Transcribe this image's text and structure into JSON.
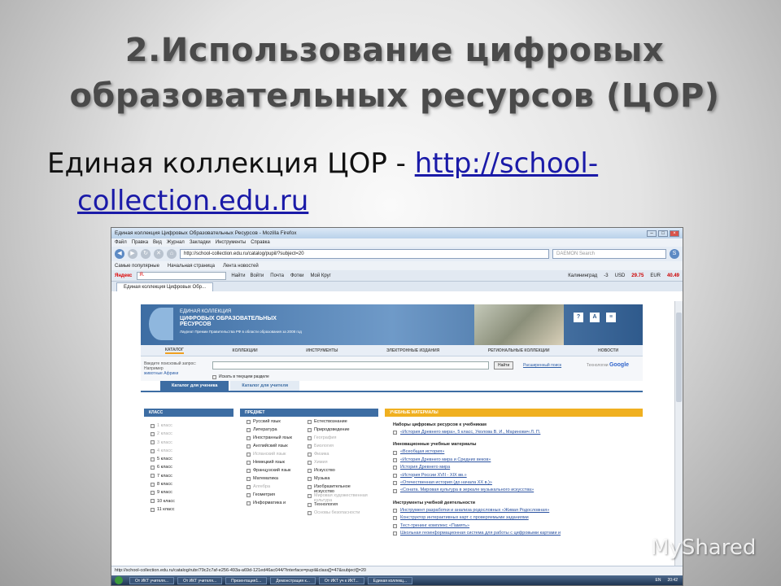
{
  "slide": {
    "title_line1": "2.Использование цифровых",
    "title_line2": "образовательных ресурсов (ЦОР)",
    "subtitle_prefix": "Единая коллекция ЦОР - ",
    "subtitle_link_part1": "http://school-",
    "subtitle_link_part2": "collection.edu.ru",
    "watermark": "MyShared"
  },
  "browser": {
    "window_title": "Единая коллекция Цифровых Образовательных Ресурсов - Mozilla Firefox",
    "menu": [
      "Файл",
      "Правка",
      "Вид",
      "Журнал",
      "Закладки",
      "Инструменты",
      "Справка"
    ],
    "url": "http://school-collection.edu.ru/catalog/pupil/?subject=20",
    "search_placeholder": "DAEMON Search",
    "bookmarks": [
      "Самые популярные",
      "Начальная страница",
      "Лента новостей"
    ],
    "yandex": {
      "logo": "Яндекс",
      "search_field": "Я.",
      "find": "Найти",
      "items": [
        "Войти",
        "Почта",
        "Фотки",
        "Мой Круг"
      ],
      "city": "Калининград",
      "weather": "-3",
      "usd_label": "USD",
      "usd": "29.75",
      "eur_label": "EUR",
      "eur": "40.49"
    },
    "tab": "Единая коллекция Цифровых Обр...",
    "status_url": "http://school-collection.edu.ru/catalog/rubr/79c2c7af-e256-493a-a69d-121ed46ac044/?interface=pupil&class[]=47&subject[]=20"
  },
  "site": {
    "header_line1": "ЕДИНАЯ КОЛЛЕКЦИЯ",
    "header_line2": "ЦИФРОВЫХ ОБРАЗОВАТЕЛЬНЫХ РЕСУРСОВ",
    "header_line3": "Лауреат Премии Правительства РФ в области образования за 2008 год",
    "header_icons": [
      "?",
      "A",
      "≡"
    ],
    "nav": [
      "КАТАЛОГ",
      "КОЛЛЕКЦИИ",
      "ИНСТРУМЕНТЫ",
      "ЭЛЕКТРОННЫЕ ИЗДАНИЯ",
      "РЕГИОНАЛЬНЫЕ КОЛЛЕКЦИИ",
      "НОВОСТИ"
    ],
    "search_label": "Введите поисковый запрос:",
    "search_example_label": "Например",
    "search_example": "животные Африки",
    "search_button": "Найти",
    "advanced_search": "Расширенный поиск",
    "google_prefix": "Технологии",
    "google": "Google",
    "search_in_section": "Искать в текущем разделе",
    "catalog_tabs": [
      "Каталог для ученика",
      "Каталог для учителя"
    ],
    "class_head": "КЛАСС",
    "classes": [
      {
        "label": "1 класс",
        "active": false
      },
      {
        "label": "2 класс",
        "active": false
      },
      {
        "label": "3 класс",
        "active": false
      },
      {
        "label": "4 класс",
        "active": false
      },
      {
        "label": "5 класс",
        "active": true
      },
      {
        "label": "6 класс",
        "active": true
      },
      {
        "label": "7 класс",
        "active": true
      },
      {
        "label": "8 класс",
        "active": true
      },
      {
        "label": "9 класс",
        "active": true
      },
      {
        "label": "10 класс",
        "active": true
      },
      {
        "label": "11 класс",
        "active": true
      }
    ],
    "subject_head": "ПРЕДМЕТ",
    "subjects_col1": [
      {
        "label": "Русский язык",
        "active": true
      },
      {
        "label": "Литература",
        "active": true
      },
      {
        "label": "Иностранный язык",
        "active": true
      },
      {
        "label": "Английский язык",
        "active": true
      },
      {
        "label": "Испанский язык",
        "active": false
      },
      {
        "label": "Немецкий язык",
        "active": true
      },
      {
        "label": "Французский язык",
        "active": true
      },
      {
        "label": "Математика",
        "active": true
      },
      {
        "label": "Алгебра",
        "active": false
      },
      {
        "label": "Геометрия",
        "active": true
      },
      {
        "label": "Информатика и",
        "active": true
      }
    ],
    "subjects_col2": [
      {
        "label": "Естествознание",
        "active": true
      },
      {
        "label": "Природоведение",
        "active": true
      },
      {
        "label": "География",
        "active": false
      },
      {
        "label": "Биология",
        "active": false
      },
      {
        "label": "Физика",
        "active": false
      },
      {
        "label": "Химия",
        "active": false
      },
      {
        "label": "Искусство",
        "active": true
      },
      {
        "label": "Музыка",
        "active": true
      },
      {
        "label": "Изобразительное искусство",
        "active": true
      },
      {
        "label": "Мировая художественная культура",
        "active": false
      },
      {
        "label": "Технология",
        "active": true
      },
      {
        "label": "Основы безопасности",
        "active": false
      }
    ],
    "materials_head": "УЧЕБНЫЕ МАТЕРИАЛЫ",
    "materials_sections": [
      {
        "title": "Наборы цифровых ресурсов к учебникам",
        "items": [
          "«История Древнего мира», 5 класс, Уколова В. И., Маринович Л. П."
        ]
      },
      {
        "title": "Инновационные учебные материалы",
        "items": [
          "«Всеобщая история»",
          "«История Древнего мира и Средних веков»",
          "История Древнего мира",
          "«История России XVII - XIX вв.»",
          "«Отечественная история (до начала XX в.)»",
          "«Соната. Мировая культура в зеркале музыкального искусства»"
        ]
      },
      {
        "title": "Инструменты учебной деятельности",
        "items": [
          "Инструмент разработки и анализа родословных «Живая Родословная»",
          "Конструктор интерактивных карт с проверяемыми заданиями",
          "Тест-тренинг комплекс «Память»",
          "Школьная геоинформационная система для работы с цифровыми картами и"
        ]
      }
    ]
  },
  "taskbar": {
    "items": [
      "От ИКТ учителя...",
      "От ИКТ учителя...",
      "Презентация1...",
      "Демонстрация к...",
      "От ИКТ уч к ИКТ...",
      "Единая коллекц..."
    ],
    "lang": "EN",
    "time": "20:42"
  }
}
